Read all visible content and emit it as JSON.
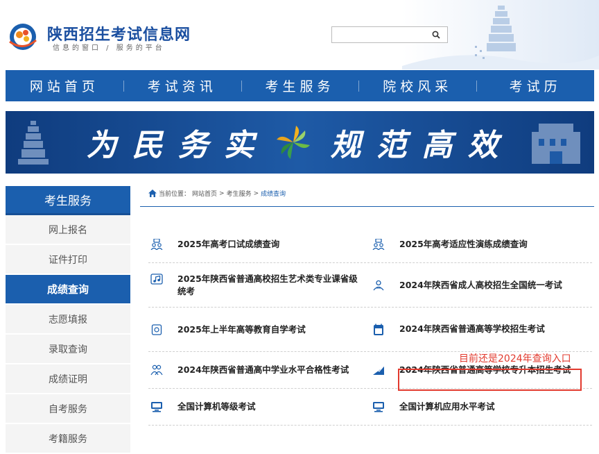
{
  "header": {
    "title": "陕西招生考试信息网",
    "subtitle": "信息的窗口 / 服务的平台",
    "search_placeholder": ""
  },
  "nav": {
    "items": [
      {
        "label": "网站首页"
      },
      {
        "label": "考试资讯"
      },
      {
        "label": "考生服务"
      },
      {
        "label": "院校风采"
      },
      {
        "label": "考试历"
      }
    ]
  },
  "banner": {
    "left_text": "为民务实",
    "right_text": "规范高效"
  },
  "sidebar": {
    "title": "考生服务",
    "items": [
      {
        "label": "网上报名",
        "active": false
      },
      {
        "label": "证件打印",
        "active": false
      },
      {
        "label": "成绩查询",
        "active": true
      },
      {
        "label": "志愿填报",
        "active": false
      },
      {
        "label": "录取查询",
        "active": false
      },
      {
        "label": "成绩证明",
        "active": false
      },
      {
        "label": "自考服务",
        "active": false
      },
      {
        "label": "考籍服务",
        "active": false
      }
    ]
  },
  "breadcrumb": {
    "prefix": "当前位置：",
    "home": "网站首页",
    "sep": ">",
    "section": "考生服务",
    "current": "成绩查询"
  },
  "links": [
    {
      "left": "2025年高考口试成绩查询",
      "right": "2025年高考适应性演练成绩查询"
    },
    {
      "left": "2025年陕西省普通高校招生艺术类专业课省级统考",
      "right": "2024年陕西省成人高校招生全国统一考试"
    },
    {
      "left": "2025年上半年高等教育自学考试",
      "right": "2024年陕西省普通高等学校招生考试"
    },
    {
      "left": "2024年陕西省普通高中学业水平合格性考试",
      "right": "2024年陕西省普通高等学校专升本招生考试"
    },
    {
      "left": "全国计算机等级考试",
      "right": "全国计算机应用水平考试"
    }
  ],
  "annotation": {
    "note": "目前还是2024年查询入口"
  },
  "colors": {
    "primary": "#1b5fae",
    "highlight": "#e23a2e"
  }
}
